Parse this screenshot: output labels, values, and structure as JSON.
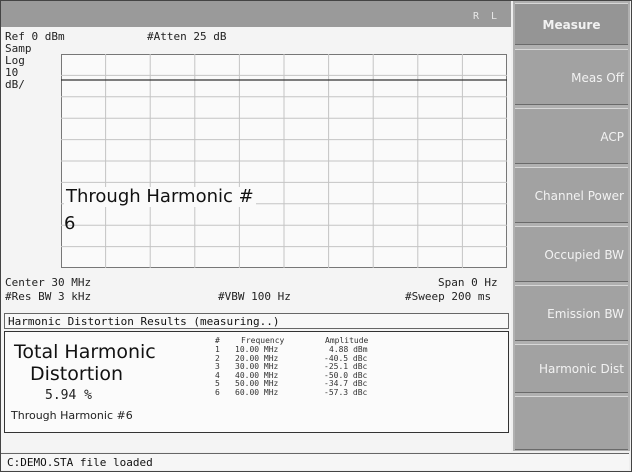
{
  "header": {
    "indicator": "R L"
  },
  "trace": {
    "ref_level": "Ref 0 dBm",
    "atten": "#Atten 25 dB",
    "detector": "Samp",
    "scale_type": "Log",
    "scale_value": "10",
    "scale_unit": "dB/",
    "overlay_line1": "Through Harmonic #",
    "overlay_line2": "6",
    "center": "Center 30 MHz",
    "span": "Span 0 Hz",
    "rbw": "#Res BW 3 kHz",
    "vbw": "#VBW 100 Hz",
    "sweep": "#Sweep 200 ms"
  },
  "results": {
    "header": "Harmonic Distortion Results (measuring..)",
    "thd_line1": "Total Harmonic",
    "thd_line2": "Distortion",
    "thd_value": "5.94 %",
    "through": "Through Harmonic #6",
    "table": {
      "headers": [
        "#",
        "Frequency",
        "Amplitude"
      ],
      "rows": [
        [
          "1",
          "10.00 MHz",
          "4.88 dBm"
        ],
        [
          "2",
          "20.00 MHz",
          "-40.5 dBc"
        ],
        [
          "3",
          "30.00 MHz",
          "-25.1 dBc"
        ],
        [
          "4",
          "40.00 MHz",
          "-50.0 dBc"
        ],
        [
          "5",
          "50.00 MHz",
          "-34.7 dBc"
        ],
        [
          "6",
          "60.00 MHz",
          "-57.3 dBc"
        ]
      ]
    }
  },
  "status": "C:DEMO.STA file loaded",
  "softkeys": {
    "title": "Measure",
    "items": [
      "Meas Off",
      "ACP",
      "Channel Power",
      "Occupied BW",
      "Emission BW",
      "Harmonic Dist",
      ""
    ]
  },
  "colors": {
    "softkey_bg": "#a2a2a2",
    "header_bar": "#9a9a9a",
    "screen_bg": "#f4f4f4"
  }
}
